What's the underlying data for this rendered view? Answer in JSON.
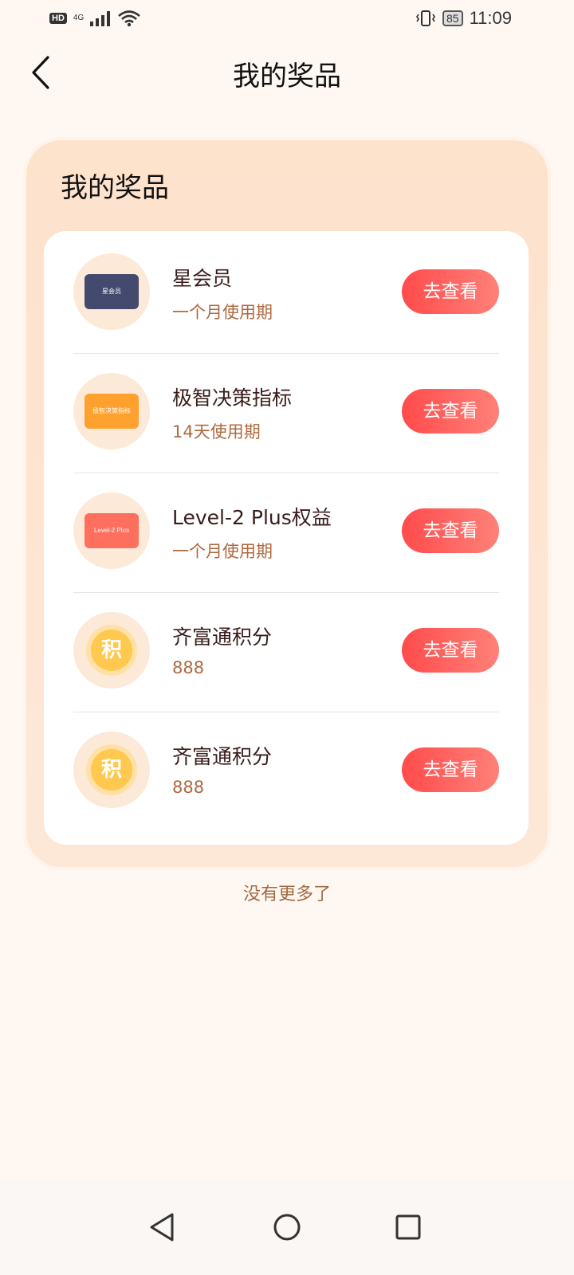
{
  "status_bar": {
    "hd": "HD",
    "network": "4G",
    "battery": "85",
    "time": "11:09"
  },
  "header": {
    "title": "我的奖品"
  },
  "panel": {
    "title": "我的奖品",
    "items": [
      {
        "name": "星会员",
        "sub": "一个月使用期",
        "button": "去查看",
        "thumb_label": "星会员",
        "thumb_kind": "dark-card"
      },
      {
        "name": "极智决策指标",
        "sub": "14天使用期",
        "button": "去查看",
        "thumb_label": "极智决策指标",
        "thumb_kind": "orange-card"
      },
      {
        "name": "Level-2 Plus权益",
        "sub": "一个月使用期",
        "button": "去查看",
        "thumb_label": "Level-2 Plus",
        "thumb_kind": "red-card"
      },
      {
        "name": "齐富通积分",
        "sub": "888",
        "button": "去查看",
        "thumb_label": "积",
        "thumb_kind": "coin"
      },
      {
        "name": "齐富通积分",
        "sub": "888",
        "button": "去查看",
        "thumb_label": "积",
        "thumb_kind": "coin"
      }
    ]
  },
  "footer_text": "没有更多了",
  "colors": {
    "accent": "#ff4b4b",
    "sub_text": "#b0683e",
    "panel_bg": "#fde2cc",
    "page_bg": "#fff8f2"
  }
}
